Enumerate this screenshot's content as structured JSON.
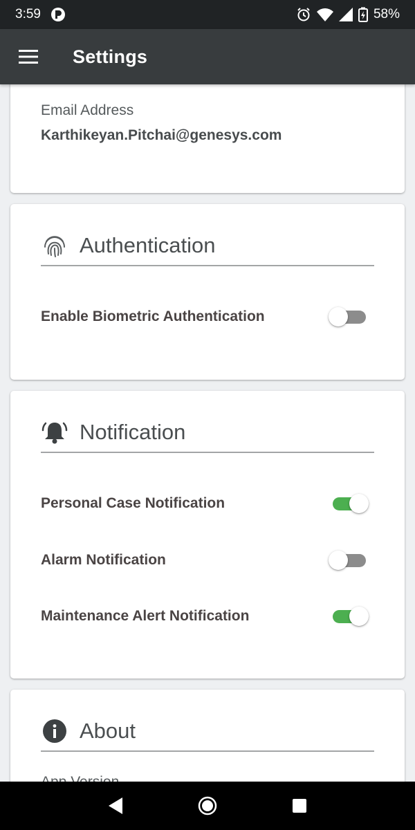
{
  "status_bar": {
    "time": "3:59",
    "battery_percent": "58%",
    "icons": [
      "app-notification-icon",
      "alarm-icon",
      "wifi-icon",
      "cell-signal-icon",
      "battery-charging-icon"
    ]
  },
  "app_bar": {
    "title": "Settings",
    "menu_icon": "hamburger-menu-icon"
  },
  "profile": {
    "email_label": "Email Address",
    "email_value": "Karthikeyan.Pitchai@genesys.com"
  },
  "authentication": {
    "title": "Authentication",
    "icon": "fingerprint-icon",
    "settings": [
      {
        "label": "Enable Biometric Authentication",
        "enabled": false
      }
    ]
  },
  "notification": {
    "title": "Notification",
    "icon": "bell-ringing-icon",
    "settings": [
      {
        "label": "Personal Case Notification",
        "enabled": true
      },
      {
        "label": "Alarm Notification",
        "enabled": false
      },
      {
        "label": "Maintenance Alert Notification",
        "enabled": true
      }
    ]
  },
  "about": {
    "title": "About",
    "icon": "info-icon",
    "partial_label": "App Version"
  },
  "colors": {
    "toolbar": "#383c3e",
    "status_bar": "#202325",
    "toggle_on": "#4caf50",
    "toggle_off": "#8c8c8c",
    "background": "#eef0f2"
  },
  "nav_bar": {
    "icons": [
      "back-icon",
      "home-icon",
      "recents-icon"
    ]
  }
}
